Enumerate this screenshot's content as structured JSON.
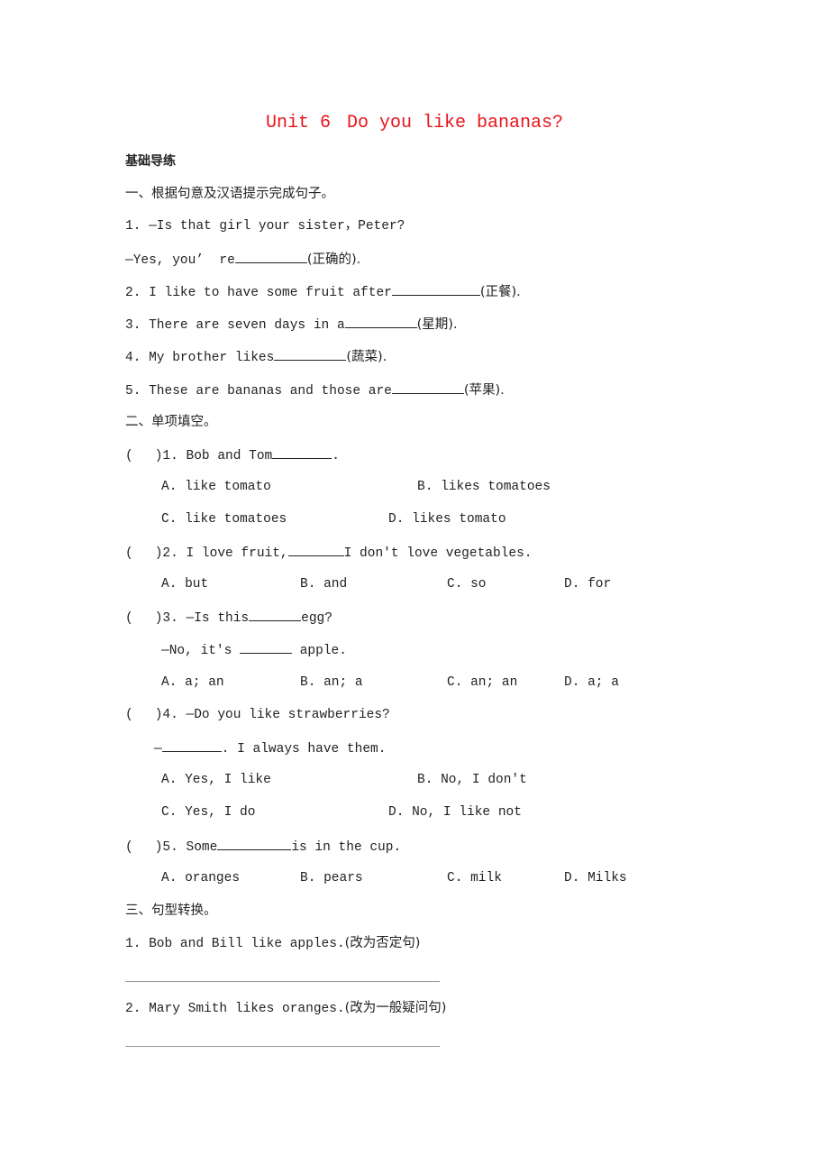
{
  "title": {
    "unit": "Unit 6",
    "question": "Do you like bananas?"
  },
  "section_heading": "基础导练",
  "part1": {
    "heading": "一、根据句意及汉语提示完成句子。",
    "items": [
      {
        "line1": "1. —Is that girl your sister，Peter?",
        "prefix": "—Yes, you’  re",
        "hint": "(正确的)."
      },
      {
        "prefix": "2. I like to have some fruit after",
        "hint": "(正餐)."
      },
      {
        "prefix": "3. There are seven days in a",
        "hint": "(星期)."
      },
      {
        "prefix": "4. My brother likes",
        "hint": "(蔬菜)."
      },
      {
        "prefix": "5. These are bananas and those are",
        "hint": "(苹果)."
      }
    ]
  },
  "part2": {
    "heading": "二、单项填空。",
    "paren_open": "(",
    "paren_close": ")",
    "questions": [
      {
        "num": "1.",
        "before": "Bob and Tom",
        "after": ".",
        "options": [
          "A. like tomato",
          "B. likes tomatoes",
          "C. like tomatoes",
          "D. likes tomato"
        ]
      },
      {
        "num": "2.",
        "before": "I love fruit,",
        "after": "I don't love vegetables.",
        "options": [
          "A. but",
          "B. and",
          "C. so",
          "D. for"
        ]
      },
      {
        "num": "3.",
        "before": "—Is this",
        "after": "egg?",
        "line2_before": "—No, it's ",
        "line2_after": " apple.",
        "options": [
          "A. a; an",
          "B. an; a",
          "C. an; an",
          "D. a; a"
        ]
      },
      {
        "num": "4.",
        "before": "—Do you like strawberries?",
        "line2_before": "—",
        "line2_after": ". I always have them.",
        "options": [
          "A. Yes, I like",
          "B. No, I don't",
          "C. Yes, I do",
          "D. No, I like not"
        ]
      },
      {
        "num": "5.",
        "before": "Some",
        "after": "is in the cup.",
        "options": [
          "A. oranges",
          "B. pears",
          "C. milk",
          "D. Milks"
        ]
      }
    ]
  },
  "part3": {
    "heading": "三、句型转换。",
    "items": [
      {
        "text": "1. Bob and Bill like apples.",
        "hint": "(改为否定句)"
      },
      {
        "text": "2. Mary Smith likes oranges.",
        "hint": "(改为一般疑问句)"
      }
    ]
  }
}
